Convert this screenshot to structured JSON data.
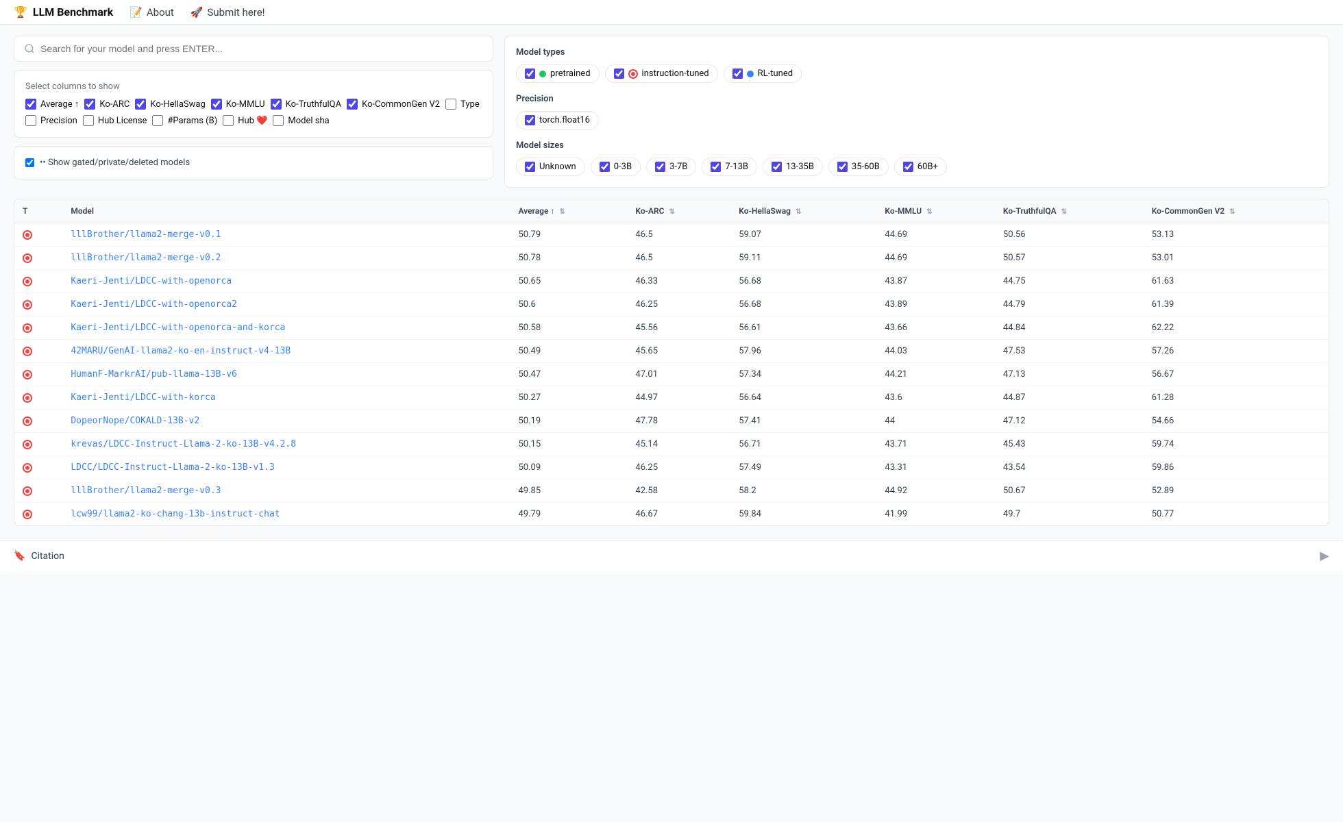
{
  "header": {
    "brand": "LLM Benchmark",
    "nav": [
      {
        "label": "About",
        "icon": "📝"
      },
      {
        "label": "Submit here!",
        "icon": "🚀"
      }
    ]
  },
  "search": {
    "placeholder": "Search for your model and press ENTER..."
  },
  "columns": {
    "section_label": "Select columns to show",
    "items": [
      {
        "id": "avg",
        "label": "Average ↑",
        "checked": true
      },
      {
        "id": "arc",
        "label": "Ko-ARC",
        "checked": true
      },
      {
        "id": "hellaswag",
        "label": "Ko-HellaSwag",
        "checked": true
      },
      {
        "id": "mmlu",
        "label": "Ko-MMLU",
        "checked": true
      },
      {
        "id": "truthfulqa",
        "label": "Ko-TruthfulQA",
        "checked": true
      },
      {
        "id": "commongen",
        "label": "Ko-CommonGen V2",
        "checked": true
      },
      {
        "id": "type",
        "label": "Type",
        "checked": false
      },
      {
        "id": "precision",
        "label": "Precision",
        "checked": false
      },
      {
        "id": "hublicense",
        "label": "Hub License",
        "checked": false
      },
      {
        "id": "params",
        "label": "#Params (B)",
        "checked": false
      },
      {
        "id": "hub",
        "label": "Hub ❤️",
        "checked": false
      },
      {
        "id": "modelsha",
        "label": "Model sha",
        "checked": false
      }
    ]
  },
  "gated": {
    "label": "•• Show gated/private/deleted models",
    "checked": true
  },
  "model_types": {
    "section_label": "Model types",
    "items": [
      {
        "id": "pretrained",
        "label": "pretrained",
        "dot": "green",
        "checked": true
      },
      {
        "id": "instruction",
        "label": "instruction-tuned",
        "dot": "red-ring",
        "checked": true
      },
      {
        "id": "rl",
        "label": "RL-tuned",
        "dot": "blue",
        "checked": true
      }
    ]
  },
  "precision": {
    "section_label": "Precision",
    "items": [
      {
        "id": "float16",
        "label": "torch.float16",
        "checked": true
      }
    ]
  },
  "model_sizes": {
    "section_label": "Model sizes",
    "items": [
      {
        "id": "unknown",
        "label": "Unknown",
        "checked": true
      },
      {
        "id": "0-3b",
        "label": "0-3B",
        "checked": true
      },
      {
        "id": "3-7b",
        "label": "3-7B",
        "checked": true
      },
      {
        "id": "7-13b",
        "label": "7-13B",
        "checked": true
      },
      {
        "id": "13-35b",
        "label": "13-35B",
        "checked": true
      },
      {
        "id": "35-60b",
        "label": "35-60B",
        "checked": true
      },
      {
        "id": "60b+",
        "label": "60B+",
        "checked": true
      }
    ]
  },
  "table": {
    "columns": [
      {
        "id": "type",
        "label": "T"
      },
      {
        "id": "model",
        "label": "Model"
      },
      {
        "id": "average",
        "label": "Average ↑"
      },
      {
        "id": "arc",
        "label": "Ko-ARC"
      },
      {
        "id": "hellaswag",
        "label": "Ko-HellaSwag"
      },
      {
        "id": "mmlu",
        "label": "Ko-MMLU"
      },
      {
        "id": "truthfulqa",
        "label": "Ko-TruthfulQA"
      },
      {
        "id": "commongen",
        "label": "Ko-CommonGen V2"
      }
    ],
    "rows": [
      {
        "type": "inst",
        "model": "lllBrother/llama2-merge-v0.1",
        "average": "50.79",
        "arc": "46.5",
        "hellaswag": "59.07",
        "mmlu": "44.69",
        "truthfulqa": "50.56",
        "commongen": "53.13"
      },
      {
        "type": "inst",
        "model": "lllBrother/llama2-merge-v0.2",
        "average": "50.78",
        "arc": "46.5",
        "hellaswag": "59.11",
        "mmlu": "44.69",
        "truthfulqa": "50.57",
        "commongen": "53.01"
      },
      {
        "type": "inst",
        "model": "Kaeri-Jenti/LDCC-with-openorca",
        "average": "50.65",
        "arc": "46.33",
        "hellaswag": "56.68",
        "mmlu": "43.87",
        "truthfulqa": "44.75",
        "commongen": "61.63"
      },
      {
        "type": "inst",
        "model": "Kaeri-Jenti/LDCC-with-openorca2",
        "average": "50.6",
        "arc": "46.25",
        "hellaswag": "56.68",
        "mmlu": "43.89",
        "truthfulqa": "44.79",
        "commongen": "61.39"
      },
      {
        "type": "inst",
        "model": "Kaeri-Jenti/LDCC-with-openorca-and-korca",
        "average": "50.58",
        "arc": "45.56",
        "hellaswag": "56.61",
        "mmlu": "43.66",
        "truthfulqa": "44.84",
        "commongen": "62.22"
      },
      {
        "type": "inst",
        "model": "42MARU/GenAI-llama2-ko-en-instruct-v4-13B",
        "average": "50.49",
        "arc": "45.65",
        "hellaswag": "57.96",
        "mmlu": "44.03",
        "truthfulqa": "47.53",
        "commongen": "57.26"
      },
      {
        "type": "inst",
        "model": "HumanF-MarkrAI/pub-llama-13B-v6",
        "average": "50.47",
        "arc": "47.01",
        "hellaswag": "57.34",
        "mmlu": "44.21",
        "truthfulqa": "47.13",
        "commongen": "56.67"
      },
      {
        "type": "inst",
        "model": "Kaeri-Jenti/LDCC-with-korca",
        "average": "50.27",
        "arc": "44.97",
        "hellaswag": "56.64",
        "mmlu": "43.6",
        "truthfulqa": "44.87",
        "commongen": "61.28"
      },
      {
        "type": "inst",
        "model": "DopeorNope/COKALD-13B-v2",
        "average": "50.19",
        "arc": "47.78",
        "hellaswag": "57.41",
        "mmlu": "44",
        "truthfulqa": "47.12",
        "commongen": "54.66"
      },
      {
        "type": "inst",
        "model": "krevas/LDCC-Instruct-Llama-2-ko-13B-v4.2.8",
        "average": "50.15",
        "arc": "45.14",
        "hellaswag": "56.71",
        "mmlu": "43.71",
        "truthfulqa": "45.43",
        "commongen": "59.74"
      },
      {
        "type": "inst",
        "model": "LDCC/LDCC-Instruct-Llama-2-ko-13B-v1.3",
        "average": "50.09",
        "arc": "46.25",
        "hellaswag": "57.49",
        "mmlu": "43.31",
        "truthfulqa": "43.54",
        "commongen": "59.86"
      },
      {
        "type": "inst",
        "model": "lllBrother/llama2-merge-v0.3",
        "average": "49.85",
        "arc": "42.58",
        "hellaswag": "58.2",
        "mmlu": "44.92",
        "truthfulqa": "50.67",
        "commongen": "52.89"
      },
      {
        "type": "inst",
        "model": "lcw99/llama2-ko-chang-13b-instruct-chat",
        "average": "49.79",
        "arc": "46.67",
        "hellaswag": "59.84",
        "mmlu": "41.99",
        "truthfulqa": "49.7",
        "commongen": "50.77"
      }
    ]
  },
  "footer": {
    "citation_label": "Citation"
  }
}
